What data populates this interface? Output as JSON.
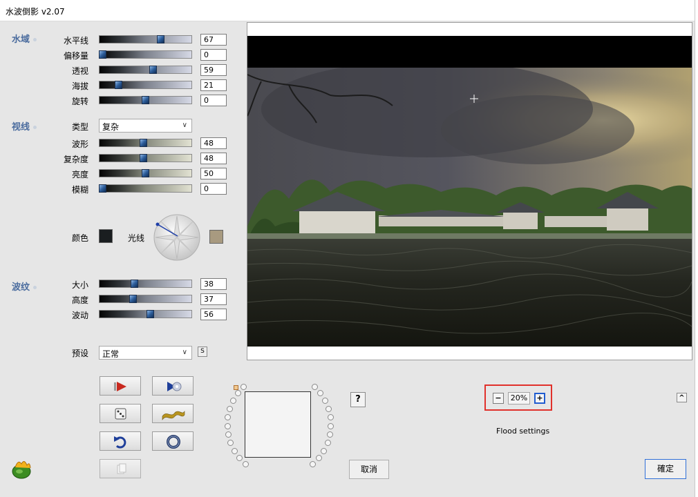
{
  "window": {
    "title": "水波倒影 v2.07"
  },
  "sections": {
    "water": "水域",
    "view": "视线",
    "ripple": "波纹"
  },
  "water_rows": [
    {
      "label": "水平线",
      "value": "67",
      "fill": 0.67
    },
    {
      "label": "偏移量",
      "value": "0",
      "fill": 0.0
    },
    {
      "label": "透视",
      "value": "59",
      "fill": 0.59
    },
    {
      "label": "海拔",
      "value": "21",
      "fill": 0.21
    },
    {
      "label": "旋转",
      "value": "0",
      "fill": 0.5
    }
  ],
  "view": {
    "type_label": "类型",
    "type_value": "复杂",
    "rows": [
      {
        "label": "波形",
        "value": "48",
        "fill": 0.48
      },
      {
        "label": "复杂度",
        "value": "48",
        "fill": 0.48
      },
      {
        "label": "亮度",
        "value": "50",
        "fill": 0.5
      },
      {
        "label": "模糊",
        "value": "0",
        "fill": 0.0
      }
    ],
    "color_label": "颜色",
    "light_label": "光线",
    "color_swatch": "#1a1e20",
    "light_swatch": "#a89a80"
  },
  "ripple_rows": [
    {
      "label": "大小",
      "value": "38",
      "fill": 0.38
    },
    {
      "label": "高度",
      "value": "37",
      "fill": 0.37
    },
    {
      "label": "波动",
      "value": "56",
      "fill": 0.56
    }
  ],
  "preset": {
    "label": "预设",
    "value": "正常",
    "save_glyph": "S"
  },
  "buttons": {
    "cancel": "取消",
    "ok": "確定",
    "help": "?",
    "collapse": "^"
  },
  "zoom": {
    "minus": "−",
    "value": "20%",
    "plus": "+"
  },
  "flood_settings": "Flood settings",
  "colors": {
    "accent": "#4b6c9e",
    "highlight": "#e0302a"
  }
}
